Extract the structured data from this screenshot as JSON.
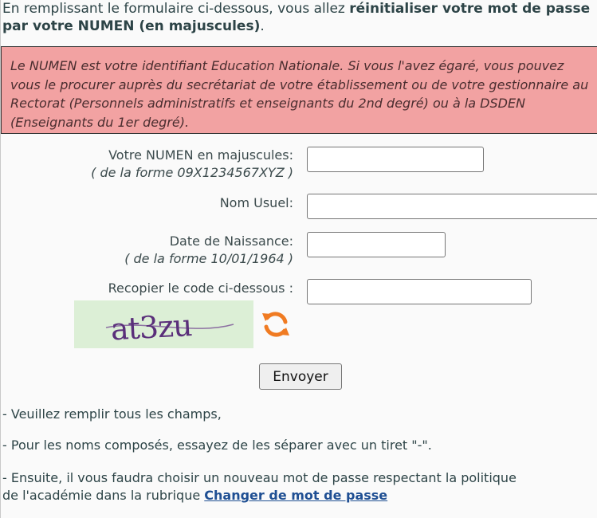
{
  "intro": {
    "prefix": "En remplissant le formulaire ci-dessous, vous allez ",
    "bold": "réinitialiser votre mot de passe par votre NUMEN (en majuscules)",
    "suffix": "."
  },
  "notice": {
    "text": "Le NUMEN est votre identifiant Education Nationale. Si vous l'avez égaré, vous pouvez vous le procurer auprès du secrétariat de votre établissement ou de votre gestionnaire au Rectorat (Personnels administratifs et enseignants du 2nd degré) ou à la DSDEN (Enseignants du 1er degré)."
  },
  "form": {
    "numen_label": "Votre NUMEN en majuscules:",
    "numen_hint": "( de la forme 09X1234567XYZ )",
    "numen_value": "",
    "nom_label": "Nom Usuel:",
    "nom_value": "",
    "date_label": "Date de Naissance:",
    "date_hint": "( de la forme 10/01/1964 )",
    "date_value": "",
    "code_label": "Recopier le code ci-dessous :",
    "code_value": "",
    "captcha_text": "at3zu",
    "submit_label": "Envoyer"
  },
  "notes": {
    "line1": "- Veuillez remplir tous les champs,",
    "line2": "- Pour les noms composés, essayez de les séparer avec un tiret \"-\".",
    "line3a": "- Ensuite, il vous faudra choisir un nouveau mot de passe respectant la politique",
    "line3b": "de l'académie dans la rubrique ",
    "link": "Changer de mot de passe"
  },
  "colors": {
    "notice_bg": "#f2a2a2",
    "link": "#1f4f93",
    "refresh_icon": "#f07b22",
    "captcha_ink": "#5a2f7a"
  }
}
